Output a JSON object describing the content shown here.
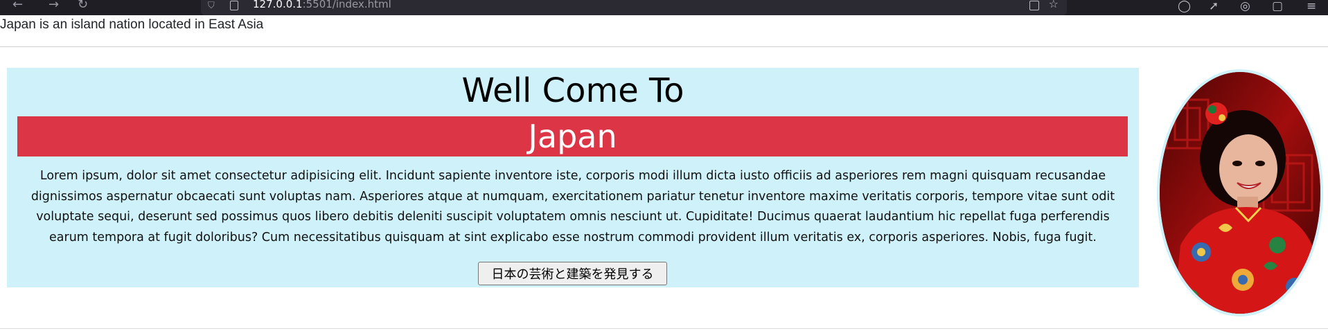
{
  "browser": {
    "url_host": "127.0.0.1",
    "url_rest": ":5501/index.html"
  },
  "header": {
    "tagline": "Japan is an island nation located in East Asia"
  },
  "hero": {
    "welcome": "Well Come To",
    "country": "Japan",
    "body": "Lorem ipsum, dolor sit amet consectetur adipisicing elit. Incidunt sapiente inventore iste, corporis modi illum dicta iusto officiis ad asperiores rem magni quisquam recusandae dignissimos aspernatur obcaecati sunt voluptas nam. Asperiores atque at numquam, exercitationem pariatur tenetur inventore maxime veritatis corporis, tempore vitae sunt odit voluptate sequi, deserunt sed possimus quos libero debitis deleniti suscipit voluptatem omnis nesciunt ut. Cupiditate! Ducimus quaerat laudantium hic repellat fuga perferendis earum tempora at fugit doloribus? Cum necessitatibus quisquam at sint explicabo esse nostrum commodi provident illum veritatis ex, corporis asperiores. Nobis, fuga fugit.",
    "button_label": "日本の芸術と建築を発見する"
  },
  "colors": {
    "hero_bg": "#cff2fa",
    "band_bg": "#dc3545",
    "band_text": "#ffffff"
  },
  "icons": [
    "back-icon",
    "forward-icon",
    "reload-icon",
    "shield-icon",
    "page-icon",
    "bookmark-icon",
    "star-icon",
    "extension-icon"
  ]
}
